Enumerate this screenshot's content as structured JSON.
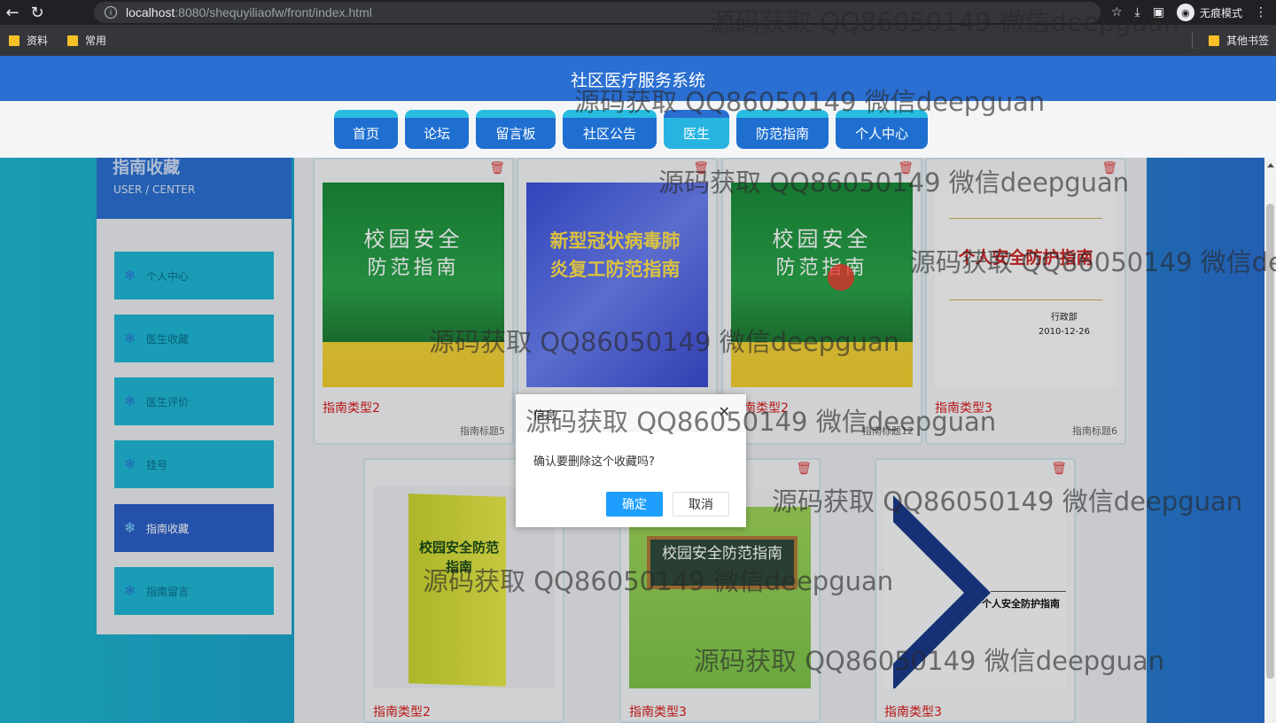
{
  "browser": {
    "url_host": "localhost",
    "url_path": ":8080/shequyiliaofw/front/index.html",
    "incognito_label": "无痕模式",
    "bookmarks": [
      "资料",
      "常用"
    ],
    "other_bookmarks": "其他书签"
  },
  "site": {
    "title": "社区医疗服务系统",
    "nav": [
      "首页",
      "论坛",
      "留言板",
      "社区公告",
      "医生",
      "防范指南",
      "个人中心"
    ],
    "active_nav": "医生"
  },
  "sidebar": {
    "title": "指南收藏",
    "subtitle": "USER / CENTER",
    "items": [
      {
        "label": "个人中心"
      },
      {
        "label": "医生收藏"
      },
      {
        "label": "医生评价"
      },
      {
        "label": "挂号"
      },
      {
        "label": "指南收藏",
        "active": true
      },
      {
        "label": "指南留言"
      }
    ]
  },
  "cards": [
    {
      "type": "指南类型2",
      "title": "指南标题5",
      "cover_line1": "校园安全",
      "cover_line2": "防范指南"
    },
    {
      "type": "",
      "title": "",
      "cover_text": "新型冠状病毒肺炎复工防范指南"
    },
    {
      "type": "指南类型2",
      "title": "指南标题12",
      "cover_line1": "校园安全",
      "cover_line2": "防范指南"
    },
    {
      "type": "指南类型3",
      "title": "指南标题6",
      "cover_text": "个人安全防护指南",
      "cover_dept": "行政部",
      "cover_date": "2010-12-26"
    },
    {
      "type": "指南类型2",
      "title": "",
      "cover_text": "校园安全防范指南"
    },
    {
      "type": "指南类型3",
      "title": "",
      "cover_text": "校园安全防范指南"
    },
    {
      "type": "指南类型3",
      "title": "",
      "cover_text": "个人安全防护指南"
    }
  ],
  "modal": {
    "title": "信息",
    "message": "确认要删除这个收藏吗?",
    "ok": "确定",
    "cancel": "取消"
  },
  "watermark": "源码获取 QQ86050149 微信deepguan"
}
